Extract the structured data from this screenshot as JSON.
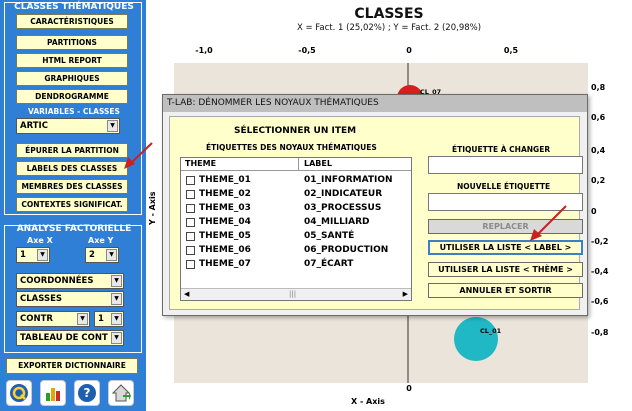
{
  "sidebar": {
    "classes_title": "CLASSES THÉMATIQUES",
    "buttons": [
      "CARACTÉRISTIQUES",
      "PARTITIONS",
      "HTML REPORT",
      "GRAPHIQUES",
      "DENDROGRAMME"
    ],
    "variables_title": "VARIABLES - CLASSES",
    "variable_selected": "ARTIC",
    "buttons2": [
      "ÉPURER LA PARTITION",
      "LABELS DES CLASSES",
      "MEMBRES DES CLASSES",
      "CONTEXTES SIGNIFICAT."
    ],
    "factor_title": "ANALYSE FACTORIELLE",
    "axe_x_label": "Axe X",
    "axe_y_label": "Axe Y",
    "axe_x_value": "1",
    "axe_y_value": "2",
    "combo_coord": "COORDONNÉES",
    "combo_classes": "CLASSES",
    "combo_contr": "CONTR",
    "combo_contr_num": "1",
    "combo_tableau": "TABLEAU DE CONT",
    "export_button": "EXPORTER DICTIONNAIRE"
  },
  "chart": {
    "title": "CLASSES",
    "subtitle": "X = Fact. 1 (25,02%) ; Y = Fact. 2 (20,98%)",
    "x_ticks": [
      "-1,0",
      "-0,5",
      "0",
      "0,5"
    ],
    "y_ticks": [
      "0,8",
      "0,6",
      "0,4",
      "0,2",
      "0",
      "-0,2",
      "-0,4",
      "-0,6",
      "-0,8"
    ],
    "xlabel": "X - Axis",
    "ylabel": "Y - Axis",
    "point_labels": [
      "CL_07",
      "CL_01"
    ],
    "colors": {
      "cl07": "#d42020",
      "cl01": "#1fb8c4"
    }
  },
  "dialog": {
    "title": "T-LAB: DÉNOMMER LES  NOYAUX THÉMATIQUES",
    "select_heading": "SÉLECTIONNER UN ITEM",
    "list_caption": "ÉTIQUETTES DES  NOYAUX THÉMATIQUES",
    "col_theme": "THEME",
    "col_label": "LABEL",
    "rows": [
      {
        "theme": "THEME_01",
        "label": "01_INFORMATION"
      },
      {
        "theme": "THEME_02",
        "label": "02_INDICATEUR"
      },
      {
        "theme": "THEME_03",
        "label": "03_PROCESSUS"
      },
      {
        "theme": "THEME_04",
        "label": "04_MILLIARD"
      },
      {
        "theme": "THEME_05",
        "label": "05_SANTÉ"
      },
      {
        "theme": "THEME_06",
        "label": "06_PRODUCTION"
      },
      {
        "theme": "THEME_07",
        "label": "07_ÉCART"
      }
    ],
    "label_to_change": "ÉTIQUETTE À  CHANGER",
    "new_label": "NOUVELLE ÉTIQUETTE",
    "btn_replace": "REPLACER",
    "btn_use_label": "UTILISER LA  LISTE  < LABEL >",
    "btn_use_theme": "UTILISER LA  LISTE  < THÈME >",
    "btn_cancel": "ANNULER ET SORTIR"
  }
}
